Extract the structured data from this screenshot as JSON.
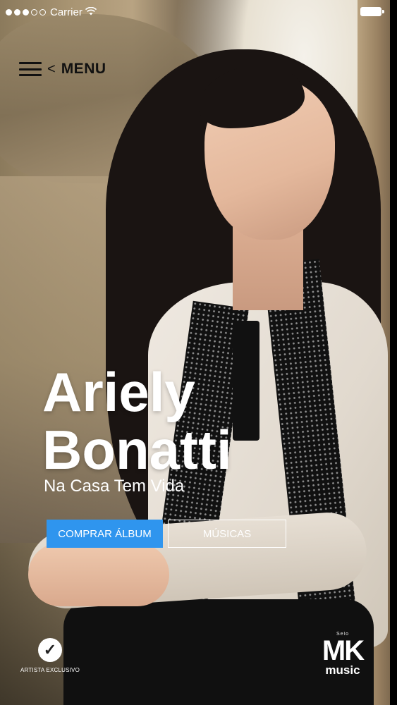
{
  "status_bar": {
    "carrier": "Carrier",
    "signal_filled": 3,
    "signal_total": 5
  },
  "menu": {
    "back_glyph": "<",
    "label": "MENU"
  },
  "artist": {
    "first_name": "Ariely",
    "last_name": "Bonatti",
    "album": "Na Casa Tem Vida"
  },
  "actions": {
    "buy_label": "COMPRAR ÁLBUM",
    "songs_label": "MÚSICAS"
  },
  "badge": {
    "label": "ARTISTA EXCLUSIVO",
    "icon": "check-circle-icon"
  },
  "record_label": {
    "small_text": "Selo",
    "logo": "MK",
    "name": "music"
  },
  "colors": {
    "accent": "#2f95ee",
    "text": "#ffffff"
  }
}
